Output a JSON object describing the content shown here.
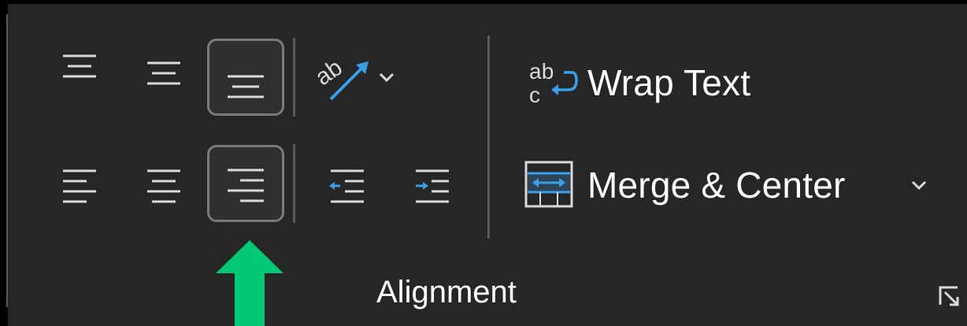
{
  "ribbon": {
    "group_label": "Alignment",
    "wrap_text_label": "Wrap Text",
    "merge_center_label": "Merge & Center"
  },
  "icons": {
    "top_align": "align-top-icon",
    "middle_align": "align-middle-icon",
    "bottom_align": "align-bottom-icon",
    "orientation": "text-orientation-icon",
    "left_align": "align-left-icon",
    "center_align": "align-center-icon",
    "right_align": "align-right-icon",
    "decrease_indent": "decrease-indent-icon",
    "increase_indent": "increase-indent-icon",
    "wrap_text": "wrap-text-icon",
    "merge_center": "merge-center-icon",
    "dialog_launcher": "dialog-launcher-icon",
    "annotation": "green-arrow-up-icon"
  },
  "state": {
    "selected_buttons": [
      "bottom-align",
      "align-right"
    ]
  },
  "colors": {
    "background": "#262626",
    "icon_stroke": "#d9d9d9",
    "accent_blue": "#3a9ee8",
    "selected_border": "#7a7a7a",
    "annotation_green": "#00c873"
  }
}
